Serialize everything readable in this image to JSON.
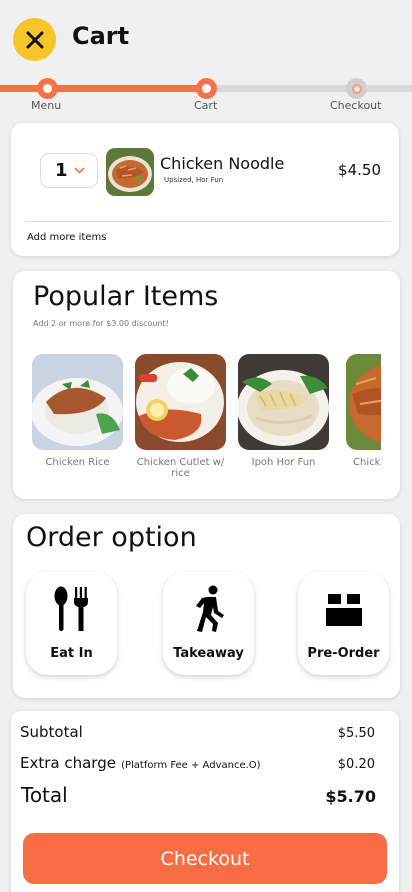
{
  "header": {
    "title": "Cart",
    "close_icon": "close-icon"
  },
  "progress": {
    "steps": [
      {
        "label": "Menu",
        "status": "done"
      },
      {
        "label": "Cart",
        "status": "current"
      },
      {
        "label": "Checkout",
        "status": "pending"
      }
    ]
  },
  "cart": {
    "items": [
      {
        "qty": "1",
        "name": "Chicken Noodle",
        "options": "Upsized, Hor Fun",
        "price": "$4.50"
      }
    ],
    "add_more": "Add more items"
  },
  "popular": {
    "title": "Popular Items",
    "subtitle": "Add 2 or more for $3.00 discount!",
    "items": [
      {
        "label": "Chicken Rice"
      },
      {
        "label": "Chicken Cutlet w/ rice"
      },
      {
        "label": "Ipoh Hor Fun"
      },
      {
        "label": "Chick"
      }
    ]
  },
  "order_option": {
    "title": "Order option",
    "options": [
      {
        "label": "Eat In",
        "icon": "utensils-icon"
      },
      {
        "label": "Takeaway",
        "icon": "walking-person-icon"
      },
      {
        "label": "Pre-Order",
        "icon": "box-icon"
      }
    ]
  },
  "summary": {
    "subtotal_label": "Subtotal",
    "subtotal": "$5.50",
    "extra_label": "Extra charge",
    "extra_note": "(Platform Fee + Advance.O)",
    "extra": "$0.20",
    "total_label": "Total",
    "total": "$5.70",
    "checkout_label": "Checkout"
  },
  "colors": {
    "accent": "#f5714a",
    "close_bg": "#f7c52a",
    "checkout_bg": "#f96d45"
  }
}
